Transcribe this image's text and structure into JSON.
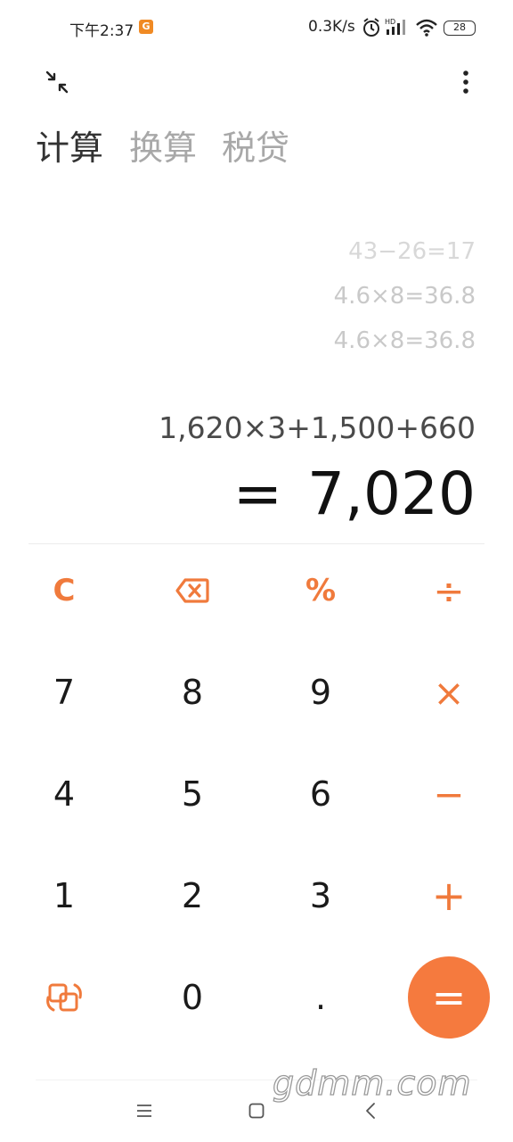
{
  "status_bar": {
    "time": "下午2:37",
    "notification_icon": "app-notification-icon",
    "net_speed": "0.3K/s",
    "battery": "28"
  },
  "toolbar": {
    "collapse_icon": "collapse-arrows-icon",
    "more_icon": "more-vertical-icon"
  },
  "tabs": [
    {
      "label": "计算",
      "active": true
    },
    {
      "label": "换算",
      "active": false
    },
    {
      "label": "税贷",
      "active": false
    }
  ],
  "history": [
    "43−26=17",
    "4.6×8=36.8",
    "4.6×8=36.8"
  ],
  "display": {
    "expression": "1,620×3+1,500+660",
    "equals_sign": "=",
    "result": "7,020"
  },
  "keypad": {
    "clear": "C",
    "backspace_icon": "backspace-icon",
    "percent": "%",
    "divide": "÷",
    "multiply": "×",
    "minus": "−",
    "plus": "+",
    "switch_icon": "switch-mode-icon",
    "equals": "=",
    "dot": ".",
    "digits": [
      "0",
      "1",
      "2",
      "3",
      "4",
      "5",
      "6",
      "7",
      "8",
      "9"
    ]
  },
  "nav": {
    "menu_icon": "menu-icon",
    "home_icon": "home-icon",
    "back_icon": "back-icon"
  },
  "watermark": "gdmm.com",
  "colors": {
    "accent": "#f57a3e",
    "text": "#1a1a1a",
    "muted": "#a8a8a8"
  }
}
